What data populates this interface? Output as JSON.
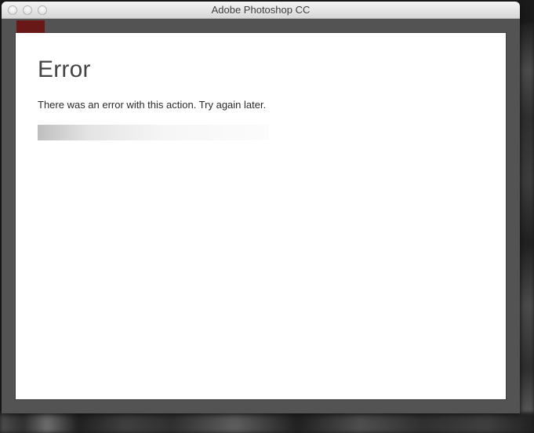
{
  "window": {
    "title": "Adobe Photoshop CC"
  },
  "dialog": {
    "heading": "Error",
    "message": "There was an error with this action. Try again later."
  }
}
